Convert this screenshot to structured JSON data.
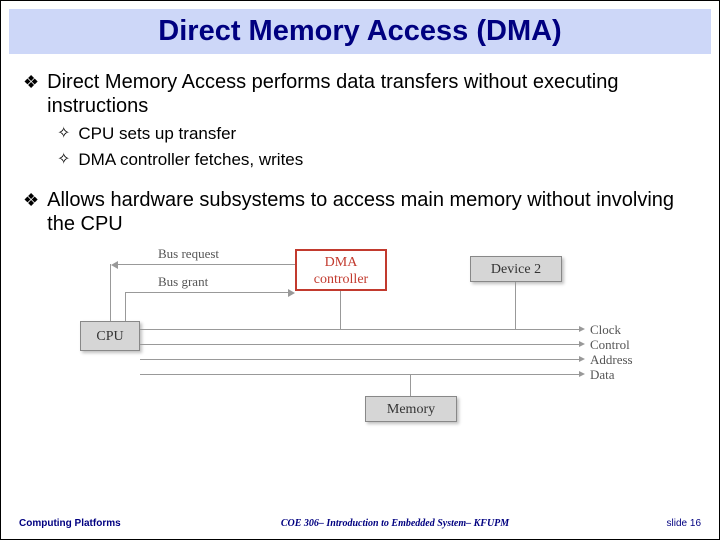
{
  "title": "Direct Memory Access (DMA)",
  "bullets": {
    "b1": "Direct Memory Access performs data transfers without executing instructions",
    "b1a": "CPU sets up transfer",
    "b1b": "DMA controller fetches, writes",
    "b2": "Allows hardware subsystems to access main memory without involving the CPU"
  },
  "diagram": {
    "bus_request": "Bus request",
    "bus_grant": "Bus grant",
    "cpu": "CPU",
    "dma": "DMA controller",
    "dev2": "Device 2",
    "memory": "Memory",
    "signals": {
      "clock": "Clock",
      "control": "Control",
      "address": "Address",
      "data": "Data"
    }
  },
  "footer": {
    "left": "Computing Platforms",
    "center": "COE 306– Introduction to Embedded System– KFUPM",
    "right": "slide 16"
  }
}
